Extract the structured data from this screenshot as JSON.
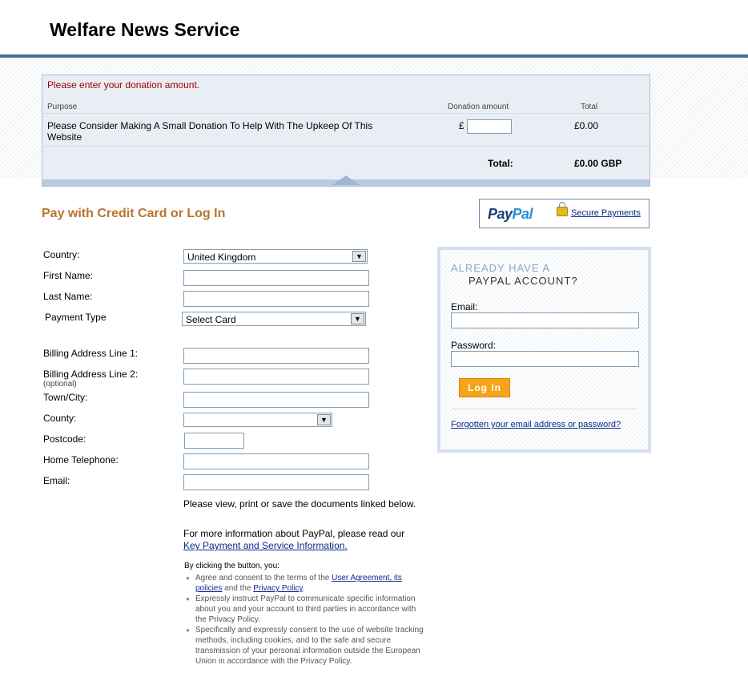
{
  "site": {
    "title": "Welfare News Service"
  },
  "cart": {
    "error_message": "Please enter your donation amount.",
    "col_purpose": "Purpose",
    "col_amount": "Donation amount",
    "col_total": "Total",
    "item_description": "Please Consider Making A Small Donation To Help With The Upkeep Of This Website",
    "currency_symbol": "£",
    "amount_value": "",
    "item_total": "£0.00",
    "total_label": "Total:",
    "total_value": "£0.00 GBP"
  },
  "header": {
    "section_title": "Pay with Credit Card or Log In",
    "paypal_logo_pay": "Pay",
    "paypal_logo_pal": "Pal",
    "secure_payments": "Secure Payments"
  },
  "form": {
    "country_label": "Country:",
    "country_value": "United Kingdom",
    "first_name_label": "First Name:",
    "last_name_label": "Last Name:",
    "payment_type_label": "Payment Type",
    "payment_type_value": "Select Card",
    "billing1_label": "Billing Address Line 1:",
    "billing2_label": "Billing Address Line 2:",
    "billing2_optional": "(optional)",
    "town_label": "Town/City:",
    "county_label": "County:",
    "county_value": "",
    "postcode_label": "Postcode:",
    "phone_label": "Home Telephone:",
    "email_label": "Email:"
  },
  "info": {
    "documents_text": "Please view, print or save the documents linked below.",
    "more_info_text": "For more information about PayPal, please read our",
    "key_payment_link": "Key Payment and Service Information.",
    "terms_intro": "By clicking the button, you:",
    "term1_prefix": "Agree and consent to the terms of the",
    "term1_link1": "User Agreement, its policies",
    "term1_mid": "and the",
    "term1_link2": "Privacy Policy",
    "term1_suffix": ".",
    "term2": "Expressly instruct PayPal to communicate specific information about you and your account to third parties in accordance with the Privacy Policy.",
    "term3": "Specifically and expressly consent to the use of website tracking methods, including cookies, and to the safe and secure transmission of your personal information outside the European Union in accordance with the Privacy Policy."
  },
  "login": {
    "heading_line1": "ALREADY HAVE A",
    "heading_line2": "PAYPAL ACCOUNT?",
    "email_label": "Email:",
    "password_label": "Password:",
    "login_button": "Log In",
    "forgot_link": "Forgotten your email address or password?"
  },
  "colors": {
    "accent_orange": "#b8742e",
    "rule_blue": "#4a6f95",
    "error_red": "#a00000",
    "button_orange": "#f5a41a"
  }
}
